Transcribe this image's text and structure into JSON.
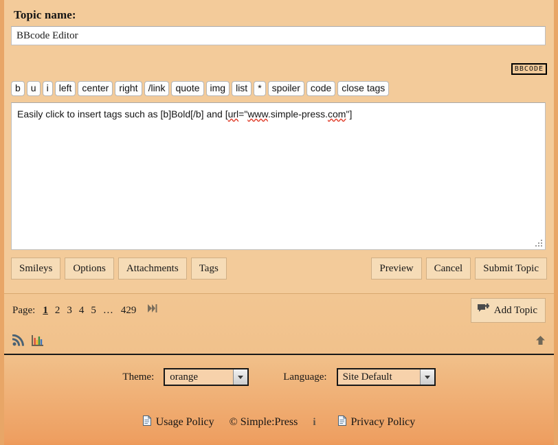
{
  "editor": {
    "topic_label": "Topic name:",
    "topic_value": "BBcode Editor",
    "topic_placeholder": "",
    "bbcode_badge": "BBCODE",
    "tag_buttons": [
      {
        "label": "b"
      },
      {
        "label": "u"
      },
      {
        "label": "i"
      },
      {
        "label": "left"
      },
      {
        "label": "center"
      },
      {
        "label": "right"
      },
      {
        "label": "/link"
      },
      {
        "label": "quote"
      },
      {
        "label": "img"
      },
      {
        "label": "list"
      },
      {
        "label": "*"
      },
      {
        "label": "spoiler"
      },
      {
        "label": "code"
      },
      {
        "label": "close tags"
      }
    ],
    "post_text_parts": {
      "p1": "Easily click to insert tags such as [b]Bold[/b] and [",
      "p2": "url",
      "p3": "=\"",
      "p4": "www",
      "p5": ".simple-press.",
      "p6": "com",
      "p7": "\"]"
    },
    "post_text_full": "Easily click to insert tags such as [b]Bold[/b] and [url=\"www.simple-press.com\"]",
    "left_buttons": [
      {
        "label": "Smileys"
      },
      {
        "label": "Options"
      },
      {
        "label": "Attachments"
      },
      {
        "label": "Tags"
      }
    ],
    "right_buttons": [
      {
        "label": "Preview"
      },
      {
        "label": "Cancel"
      },
      {
        "label": "Submit Topic"
      }
    ]
  },
  "pagination": {
    "label": "Page:",
    "pages": [
      {
        "label": "1",
        "current": true
      },
      {
        "label": "2",
        "current": false
      },
      {
        "label": "3",
        "current": false
      },
      {
        "label": "4",
        "current": false
      },
      {
        "label": "5",
        "current": false
      }
    ],
    "ellipsis": "…",
    "last_page": "429",
    "jump_icon": "jump-to-last-page-icon",
    "add_topic_label": "Add Topic",
    "add_topic_icon": "add-topic-bubble-icon"
  },
  "icon_bar": {
    "rss_icon": "rss-feed-icon",
    "stats_icon": "statistics-bar-chart-icon",
    "top_icon": "scroll-to-top-arrow-icon"
  },
  "selectors": {
    "theme_label": "Theme:",
    "theme_value": "orange",
    "language_label": "Language:",
    "language_value": "Site Default"
  },
  "footer": {
    "usage_policy": "Usage Policy",
    "copyright": "© Simple:Press",
    "privacy_policy": "Privacy Policy",
    "doc_icon": "document-icon",
    "info_icon": "info-icon"
  },
  "colors": {
    "page_top": "#f3cb9a",
    "page_bottom": "#ed9a5a",
    "frame_border": "#e8a667",
    "button_face": "#f6dcb7",
    "button_border": "#cfae84",
    "divider": "#181818",
    "spellcheck_underline": "#e03b28"
  }
}
